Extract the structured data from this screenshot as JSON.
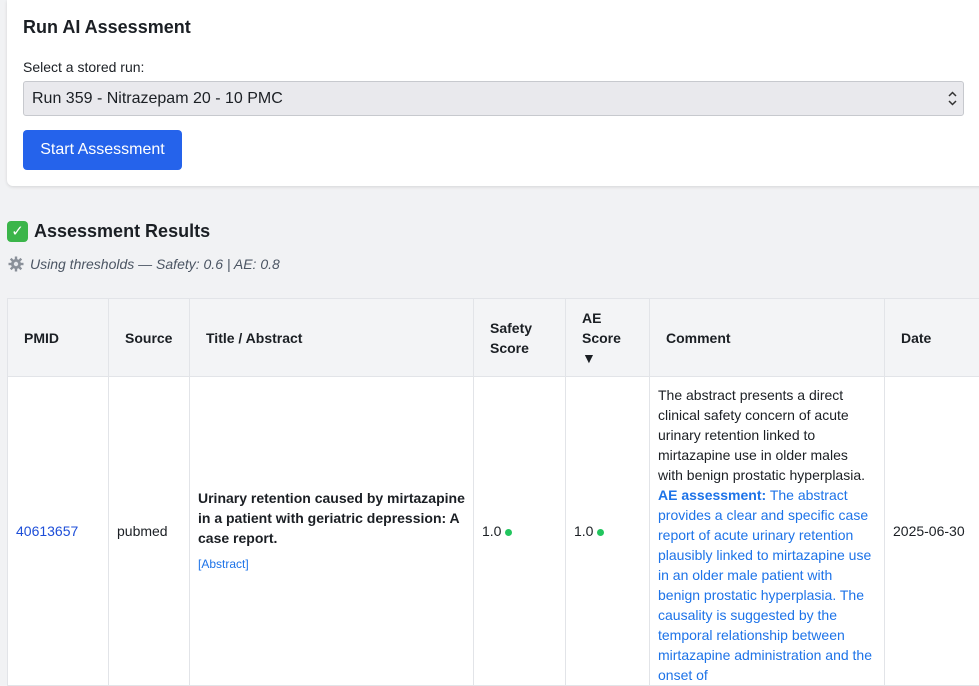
{
  "panel": {
    "title": "Run AI Assessment",
    "select_label": "Select a stored run:",
    "selected_run": "Run 359 - Nitrazepam 20 - 10 PMC",
    "start_button": "Start Assessment"
  },
  "results": {
    "title": "Assessment Results",
    "thresholds": "Using thresholds — Safety: 0.6 | AE: 0.8"
  },
  "table": {
    "headers": {
      "pmid": "PMID",
      "source": "Source",
      "title": "Title / Abstract",
      "safety_line1": "Safety",
      "safety_line2": "Score",
      "ae_line1": "AE",
      "ae_line2": "Score",
      "ae_sort": "▼",
      "comment": "Comment",
      "date": "Date"
    },
    "rows": [
      {
        "pmid": "40613657",
        "source": "pubmed",
        "title": "Urinary retention caused by mirtazapine in a patient with geriatric depression: A case report.",
        "abstract_link": "[Abstract]",
        "safety_score": "1.0",
        "ae_score": "1.0",
        "comment": "The abstract presents a direct clinical safety concern of acute urinary retention linked to mirtazapine use in older males with benign prostatic hyperplasia.",
        "ae_label": "AE assessment:",
        "ae_comment": "The abstract provides a clear and specific case report of acute urinary retention plausibly linked to mirtazapine use in an older male patient with benign prostatic hyperplasia. The causality is suggested by the temporal relationship between mirtazapine administration and the onset of",
        "date": "2025-06-30"
      }
    ]
  },
  "colors": {
    "accent": "#2563eb",
    "link": "#1d4ed8",
    "score_dot": "#22c55e"
  }
}
